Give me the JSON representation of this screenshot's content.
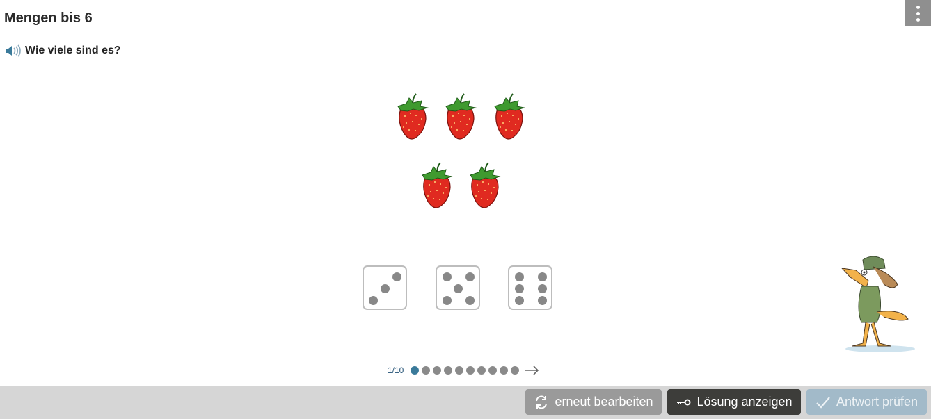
{
  "header": {
    "title": "Mengen bis 6"
  },
  "menu": {
    "icon": "kebab-menu-icon"
  },
  "question": {
    "text": "Wie viele sind es?",
    "icon": "speaker-icon"
  },
  "task": {
    "strawberry_count": 5,
    "item_icon": "strawberry-icon"
  },
  "answers": [
    {
      "value": 3,
      "icon": "die-three-icon"
    },
    {
      "value": 5,
      "icon": "die-five-icon"
    },
    {
      "value": 6,
      "icon": "die-six-icon"
    }
  ],
  "progress": {
    "label": "1/10",
    "current": 1,
    "total": 10,
    "next_icon": "arrow-right-icon"
  },
  "footer": {
    "redo_label": "erneut bearbeiten",
    "solution_label": "Lösung anzeigen",
    "check_label": "Antwort prüfen"
  },
  "colors": {
    "footer_bg": "#d6d6d6",
    "redo_bg": "#9a9a9a",
    "solution_bg": "#3d3d3a",
    "check_bg": "#a2bac9",
    "active_dot": "#3a7a9a"
  }
}
